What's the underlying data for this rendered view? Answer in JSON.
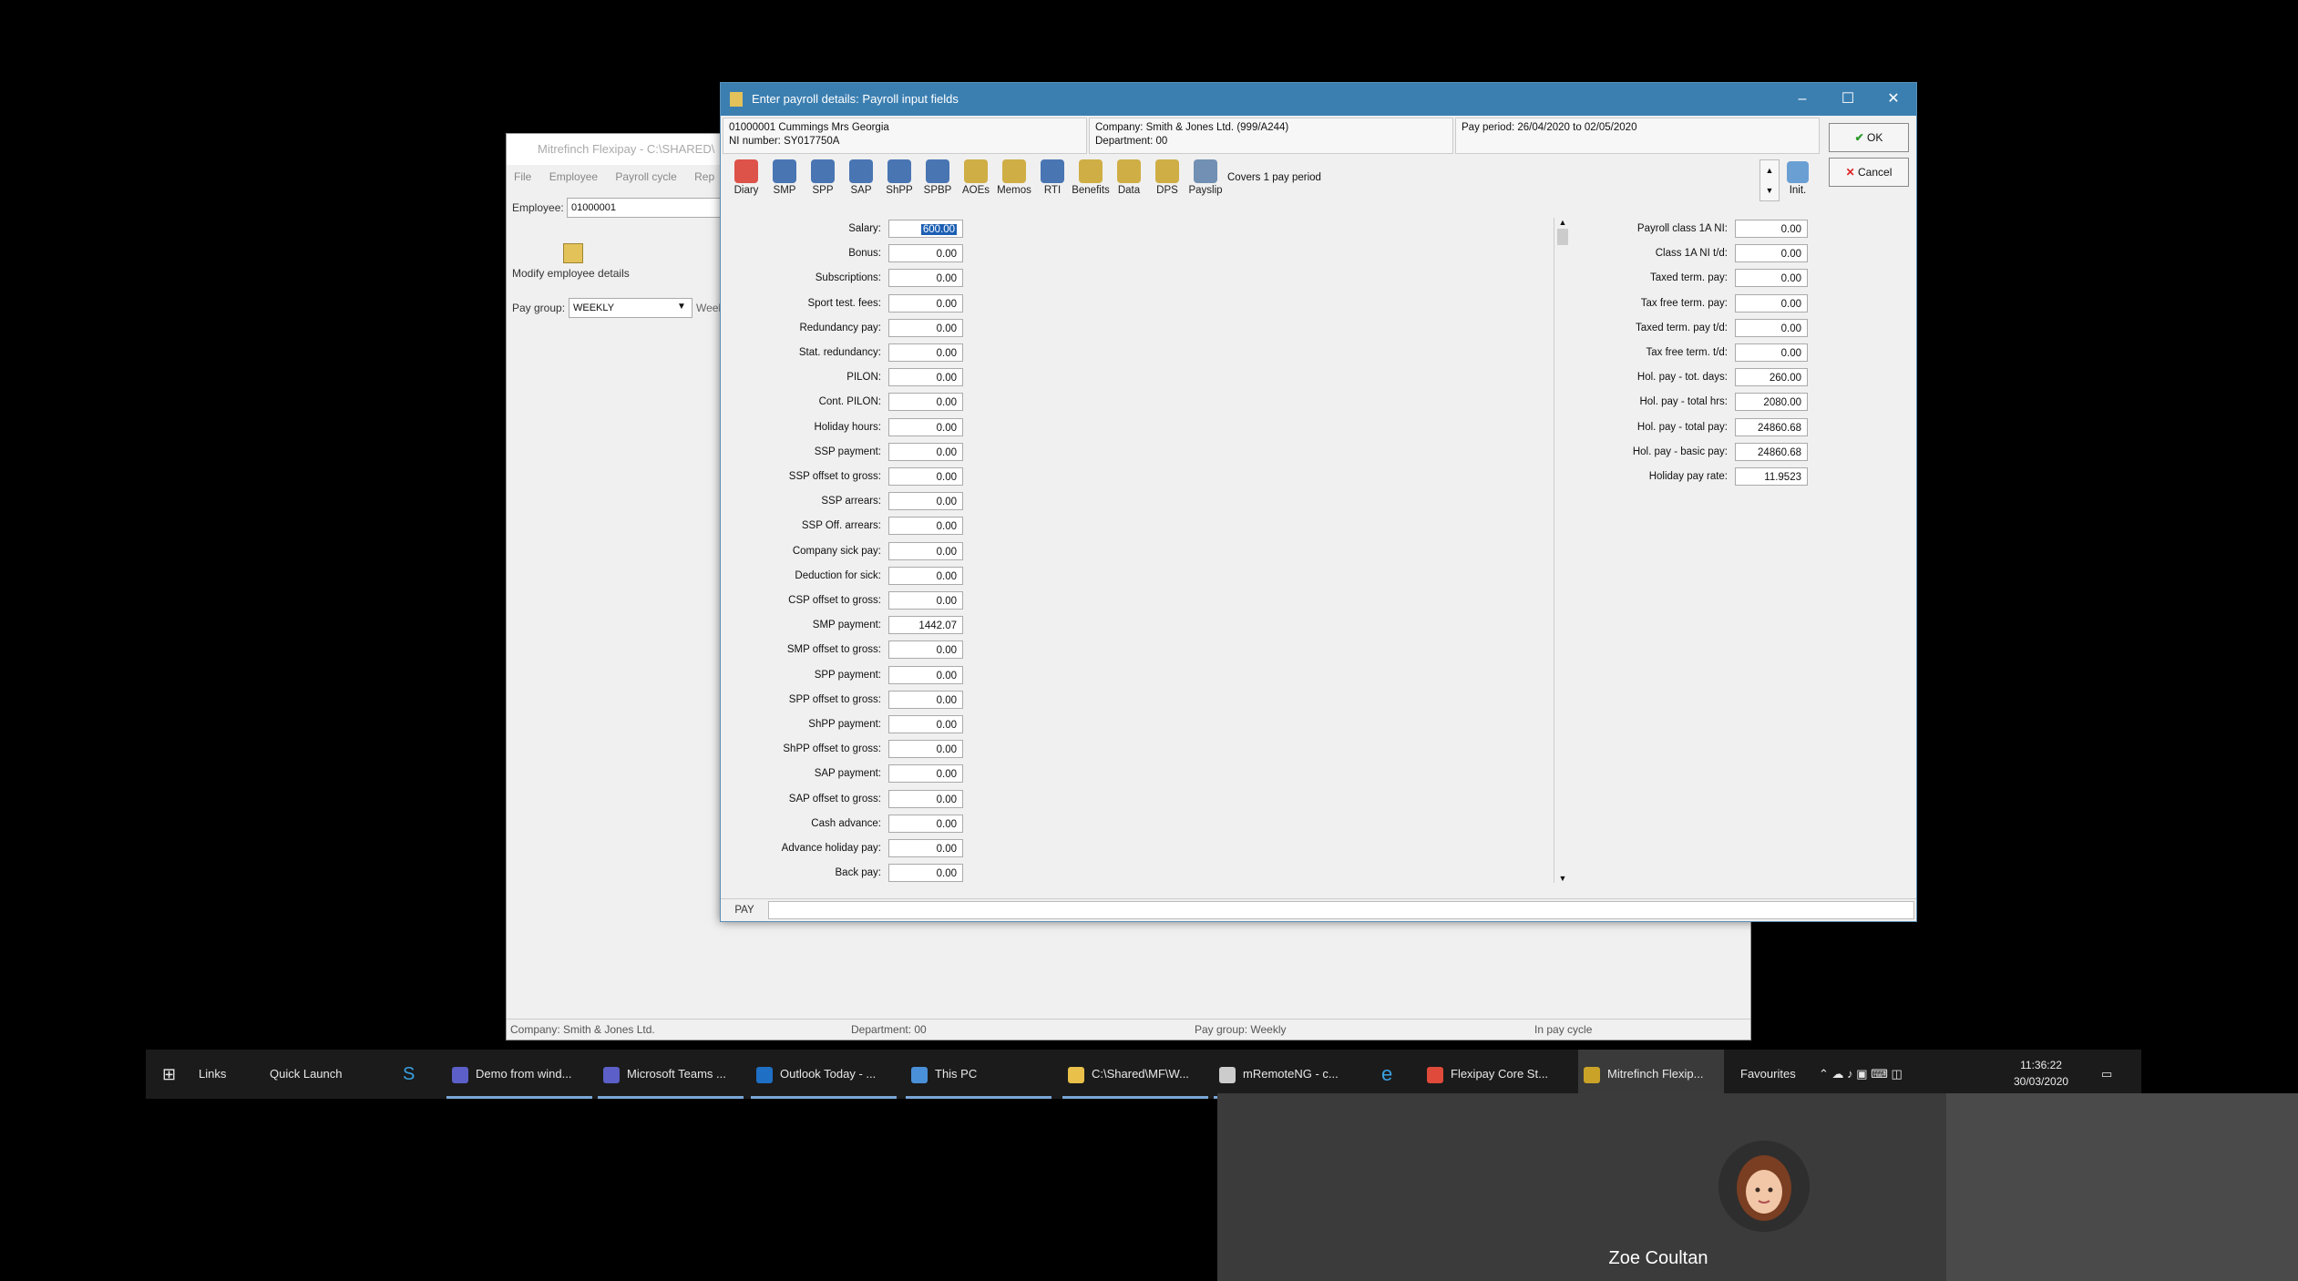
{
  "bg_window": {
    "title": "Mitrefinch Flexipay - C:\\SHARED\\",
    "menu": [
      "File",
      "Employee",
      "Payroll cycle",
      "Rep"
    ],
    "employee_label": "Employee:",
    "employee_value": "01000001",
    "modify_label": "Modify employee details",
    "pay_group_label": "Pay group:",
    "pay_group_value": "WEEKLY",
    "pay_group_suffix": "Week",
    "status": {
      "company": "Company: Smith & Jones Ltd.",
      "department": "Department: 00",
      "pay_group": "Pay group: Weekly",
      "cycle": "In pay cycle"
    }
  },
  "dialog": {
    "title": "Enter payroll details: Payroll input fields",
    "employee_line1": "01000001 Cummings Mrs Georgia",
    "employee_line2": "NI number: SY017750A",
    "company_line1": "Company: Smith & Jones Ltd. (999/A244)",
    "company_line2": "Department: 00",
    "pay_period": "Pay period: 26/04/2020 to 02/05/2020",
    "covers": "Covers 1 pay period",
    "ok_label": "OK",
    "cancel_label": "Cancel",
    "init_label": "Init.",
    "tab_label": "PAY",
    "toolbar": [
      {
        "label": "Diary",
        "color": "#d9362b"
      },
      {
        "label": "SMP",
        "color": "#2b5fa8"
      },
      {
        "label": "SPP",
        "color": "#2b5fa8"
      },
      {
        "label": "SAP",
        "color": "#2b5fa8"
      },
      {
        "label": "ShPP",
        "color": "#2b5fa8"
      },
      {
        "label": "SPBP",
        "color": "#2b5fa8"
      },
      {
        "label": "AOEs",
        "color": "#c9a227"
      },
      {
        "label": "Memos",
        "color": "#c9a227"
      },
      {
        "label": "RTI",
        "color": "#2b5fa8"
      },
      {
        "label": "Benefits",
        "color": "#c9a227"
      },
      {
        "label": "Data",
        "color": "#c9a227"
      },
      {
        "label": "DPS",
        "color": "#c9a227"
      },
      {
        "label": "Payslip",
        "color": "#5a7fa8"
      }
    ],
    "left_fields": [
      {
        "label": "Salary:",
        "value": "600.00"
      },
      {
        "label": "Bonus:",
        "value": "0.00"
      },
      {
        "label": "Subscriptions:",
        "value": "0.00"
      },
      {
        "label": "Sport test. fees:",
        "value": "0.00"
      },
      {
        "label": "Redundancy pay:",
        "value": "0.00"
      },
      {
        "label": "Stat. redundancy:",
        "value": "0.00"
      },
      {
        "label": "PILON:",
        "value": "0.00"
      },
      {
        "label": "Cont. PILON:",
        "value": "0.00"
      },
      {
        "label": "Holiday hours:",
        "value": "0.00"
      },
      {
        "label": "SSP payment:",
        "value": "0.00"
      },
      {
        "label": "SSP offset to gross:",
        "value": "0.00"
      },
      {
        "label": "SSP arrears:",
        "value": "0.00"
      },
      {
        "label": "SSP Off. arrears:",
        "value": "0.00"
      },
      {
        "label": "Company sick pay:",
        "value": "0.00"
      },
      {
        "label": "Deduction for sick:",
        "value": "0.00"
      },
      {
        "label": "CSP offset to gross:",
        "value": "0.00"
      },
      {
        "label": "SMP payment:",
        "value": "1442.07"
      },
      {
        "label": "SMP offset to gross:",
        "value": "0.00"
      },
      {
        "label": "SPP payment:",
        "value": "0.00"
      },
      {
        "label": "SPP offset to gross:",
        "value": "0.00"
      },
      {
        "label": "ShPP payment:",
        "value": "0.00"
      },
      {
        "label": "ShPP offset to gross:",
        "value": "0.00"
      },
      {
        "label": "SAP payment:",
        "value": "0.00"
      },
      {
        "label": "SAP offset to gross:",
        "value": "0.00"
      },
      {
        "label": "Cash advance:",
        "value": "0.00"
      },
      {
        "label": "Advance holiday pay:",
        "value": "0.00"
      },
      {
        "label": "Back pay:",
        "value": "0.00"
      }
    ],
    "right_fields": [
      {
        "label": "Payroll class 1A NI:",
        "value": "0.00"
      },
      {
        "label": "Class 1A NI t/d:",
        "value": "0.00"
      },
      {
        "label": "Taxed term. pay:",
        "value": "0.00"
      },
      {
        "label": "Tax free term. pay:",
        "value": "0.00"
      },
      {
        "label": "Taxed term. pay t/d:",
        "value": "0.00"
      },
      {
        "label": "Tax free term. t/d:",
        "value": "0.00"
      },
      {
        "label": "Hol. pay - tot. days:",
        "value": "260.00"
      },
      {
        "label": "Hol. pay - total hrs:",
        "value": "2080.00"
      },
      {
        "label": "Hol. pay - total pay:",
        "value": "24860.68"
      },
      {
        "label": "Hol. pay - basic pay:",
        "value": "24860.68"
      },
      {
        "label": "Holiday pay rate:",
        "value": "11.9523"
      }
    ]
  },
  "taskbar": {
    "links": "Links",
    "quick_launch": "Quick Launch",
    "items": [
      {
        "label": "Demo from wind...",
        "color": "#5b5fc7"
      },
      {
        "label": "Microsoft Teams ...",
        "color": "#5b5fc7"
      },
      {
        "label": "Outlook Today - ...",
        "color": "#1f6fc5"
      },
      {
        "label": "This PC",
        "color": "#4a90d9"
      },
      {
        "label": "C:\\Shared\\MF\\W...",
        "color": "#e8c04a"
      },
      {
        "label": "mRemoteNG - c...",
        "color": "#cccccc"
      },
      {
        "label": "Flexipay Core St...",
        "color": "#e04a3a"
      },
      {
        "label": "Mitrefinch Flexip...",
        "color": "#c9a227"
      }
    ],
    "favourites": "Favourites",
    "time": "11:36:22",
    "date": "30/03/2020"
  },
  "call": {
    "participant": "Zoe Coultan"
  }
}
